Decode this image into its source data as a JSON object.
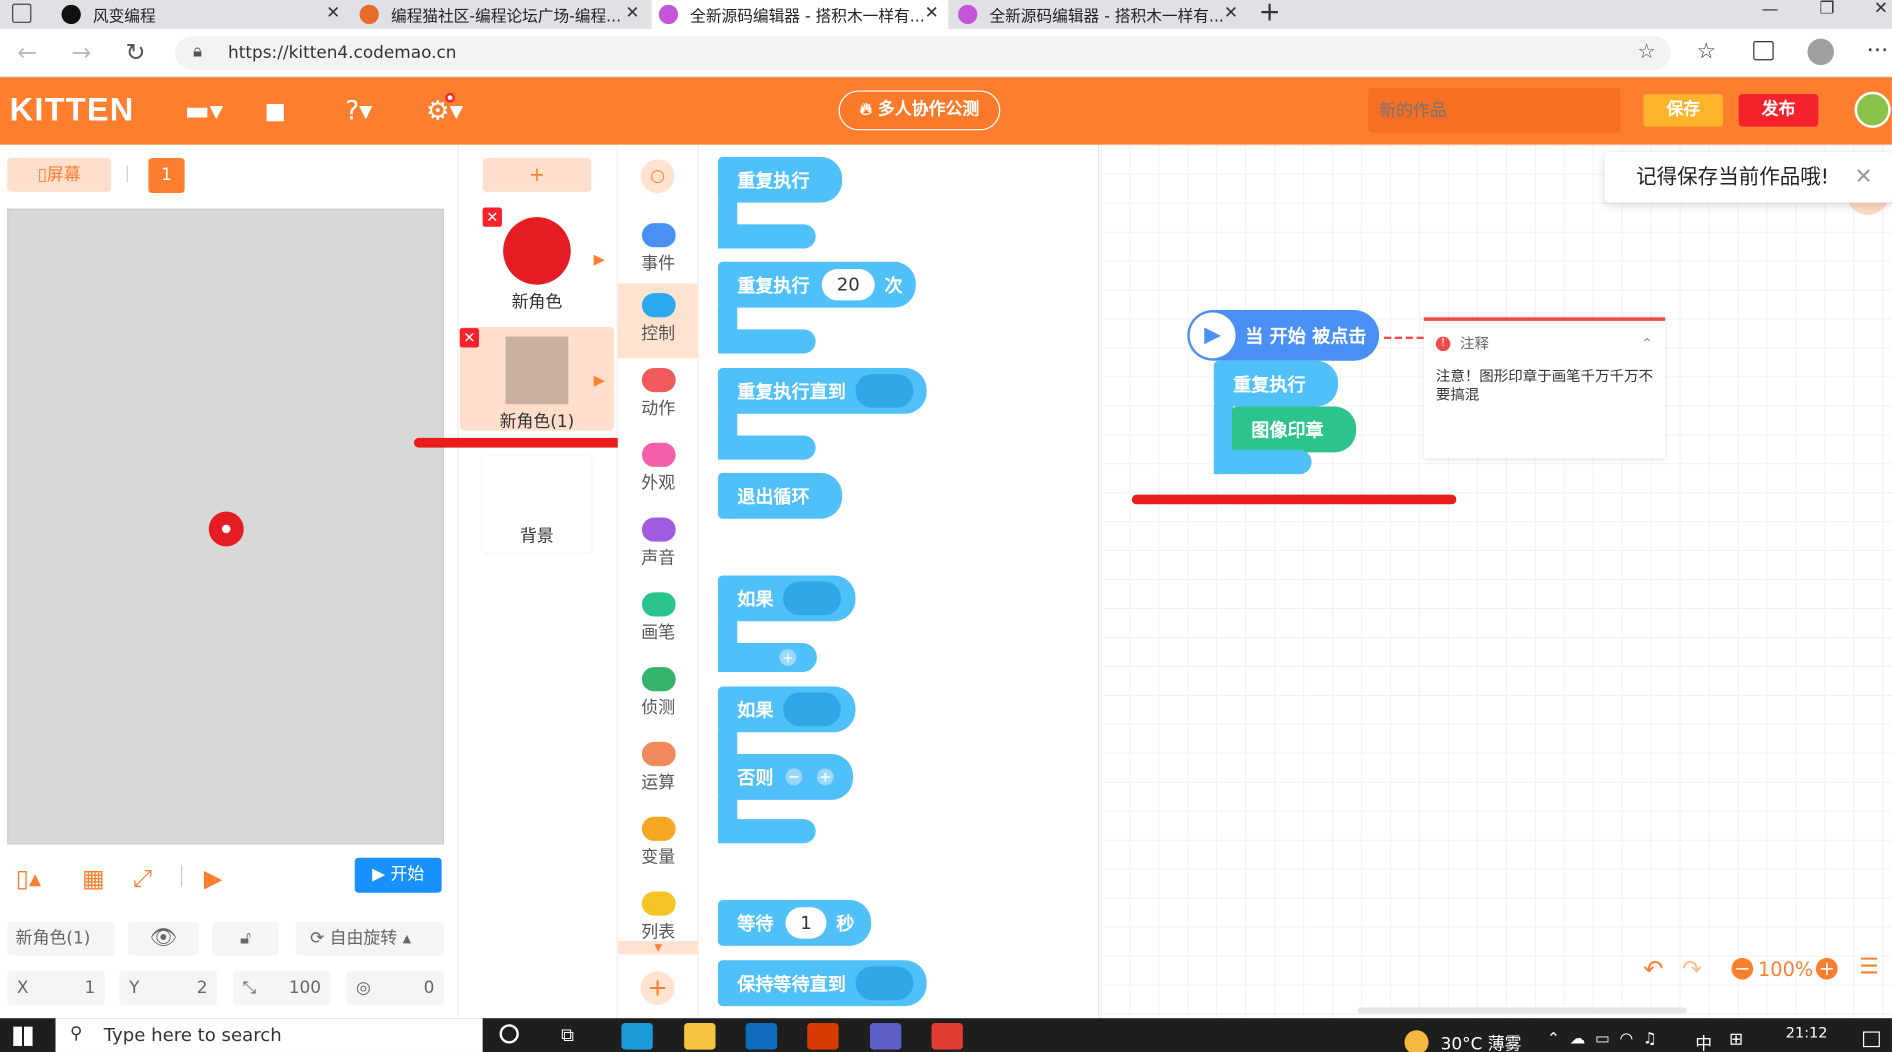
{
  "browser": {
    "tabs": [
      {
        "label": "风变编程"
      },
      {
        "label": "编程猫社区-编程论坛广场-编程..."
      },
      {
        "label": "全新源码编辑器 - 搭积木一样有..."
      },
      {
        "label": "全新源码编辑器 - 搭积木一样有..."
      }
    ],
    "url": "https://kitten4.codemao.cn"
  },
  "header": {
    "logo": "KITTEN",
    "collab_label": "多人协作公测",
    "title_placeholder": "新的作品",
    "save_label": "保存",
    "publish_label": "发布"
  },
  "stage": {
    "screen_label": "屏幕",
    "screen_number": "1",
    "start_label": "开始"
  },
  "sprite_props": {
    "name": "新角色(1)",
    "rotate_label": "自由旋转",
    "x_label": "X",
    "x_value": "1",
    "y_label": "Y",
    "y_value": "2",
    "size_value": "100",
    "angle_value": "0"
  },
  "sprites": [
    {
      "name": "新角色"
    },
    {
      "name": "新角色(1)"
    },
    {
      "name": "背景"
    }
  ],
  "categories": [
    {
      "label": "事件",
      "color": "#4a90f4"
    },
    {
      "label": "控制",
      "color": "#2ba9f0"
    },
    {
      "label": "动作",
      "color": "#f05a5a"
    },
    {
      "label": "外观",
      "color": "#f560a8"
    },
    {
      "label": "声音",
      "color": "#a05ce0"
    },
    {
      "label": "画笔",
      "color": "#2bc48a"
    },
    {
      "label": "侦测",
      "color": "#34b36b"
    },
    {
      "label": "运算",
      "color": "#f08a5a"
    },
    {
      "label": "变量",
      "color": "#f5a623"
    },
    {
      "label": "列表",
      "color": "#f5c323"
    }
  ],
  "palette": {
    "repeat_forever": "重复执行",
    "repeat": "重复执行",
    "repeat_count": "20",
    "repeat_times": "次",
    "repeat_until": "重复执行直到",
    "exit_loop": "退出循环",
    "if1": "如果",
    "if2": "如果",
    "else": "否则",
    "wait": "等待",
    "wait_value": "1",
    "wait_unit": "秒",
    "wait_until": "保持等待直到"
  },
  "script": {
    "hat": "当 开始 被点击",
    "loop": "重复执行",
    "stamp": "图像印章"
  },
  "note": {
    "title": "注释",
    "text": "注意！图形印章于画笔千万千万不要搞混"
  },
  "toast": "记得保存当前作品哦!",
  "zoom": "100%",
  "taskbar": {
    "search_placeholder": "Type here to search",
    "weather": "30°C 薄雾",
    "ime": "中",
    "time": "21:12"
  }
}
